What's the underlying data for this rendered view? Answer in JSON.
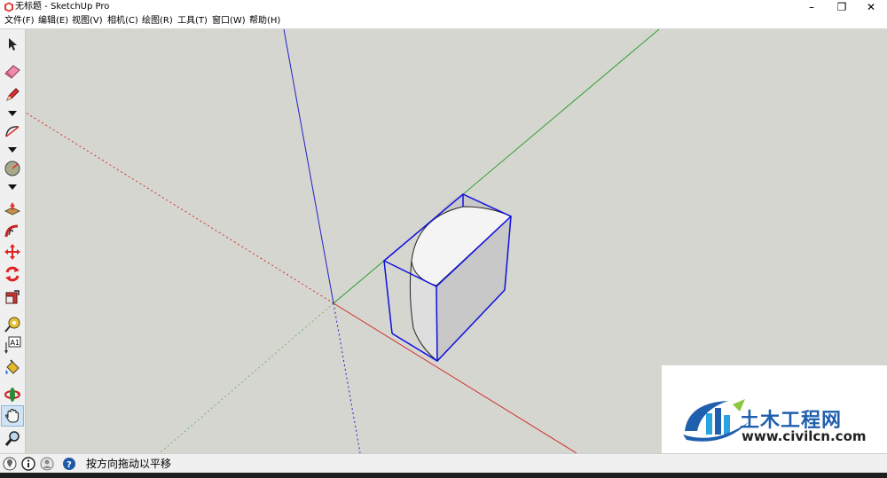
{
  "window": {
    "title": "无标题 - SketchUp Pro",
    "controls": {
      "minimize": "–",
      "restore": "❐",
      "close": "✕"
    }
  },
  "menu": [
    {
      "label": "文件(F)"
    },
    {
      "label": "编辑(E)"
    },
    {
      "label": "视图(V)"
    },
    {
      "label": "相机(C)"
    },
    {
      "label": "绘图(R)"
    },
    {
      "label": "工具(T)"
    },
    {
      "label": "窗口(W)"
    },
    {
      "label": "帮助(H)"
    }
  ],
  "toolbar": {
    "tools": [
      {
        "name": "select-tool",
        "icon": "arrow-icon"
      },
      {
        "name": "eraser-tool",
        "icon": "eraser-icon"
      },
      {
        "name": "line-tool",
        "icon": "pencil-icon"
      },
      {
        "name": "arc-tool",
        "icon": "arc-icon"
      },
      {
        "name": "shape-tool",
        "icon": "circle-icon"
      },
      {
        "name": "push-pull-tool",
        "icon": "push-pull-icon"
      },
      {
        "name": "follow-me-tool",
        "icon": "follow-me-icon"
      },
      {
        "name": "move-tool",
        "icon": "move-icon"
      },
      {
        "name": "rotate-tool",
        "icon": "rotate-icon"
      },
      {
        "name": "scale-tool",
        "icon": "scale-icon"
      },
      {
        "name": "tape-measure-tool",
        "icon": "tape-icon"
      },
      {
        "name": "text-tool",
        "icon": "text-icon"
      },
      {
        "name": "paint-bucket-tool",
        "icon": "paint-bucket-icon"
      },
      {
        "name": "orbit-tool",
        "icon": "orbit-icon"
      },
      {
        "name": "pan-tool",
        "icon": "hand-icon",
        "active": true
      },
      {
        "name": "zoom-tool",
        "icon": "magnifier-icon"
      }
    ],
    "text_tool_label": "A1"
  },
  "status": {
    "message": "按方向拖动以平移",
    "icons": [
      "geo-location-icon",
      "credits-icon",
      "account-icon",
      "help-icon"
    ]
  },
  "watermark": {
    "title": "土木工程网",
    "url": "www.civilcn.com"
  },
  "colors": {
    "viewport_bg": "#d6d6d0",
    "axis_red": "#d03030",
    "axis_green": "#30a030",
    "axis_blue": "#2020c8",
    "selection": "#1010e0"
  }
}
